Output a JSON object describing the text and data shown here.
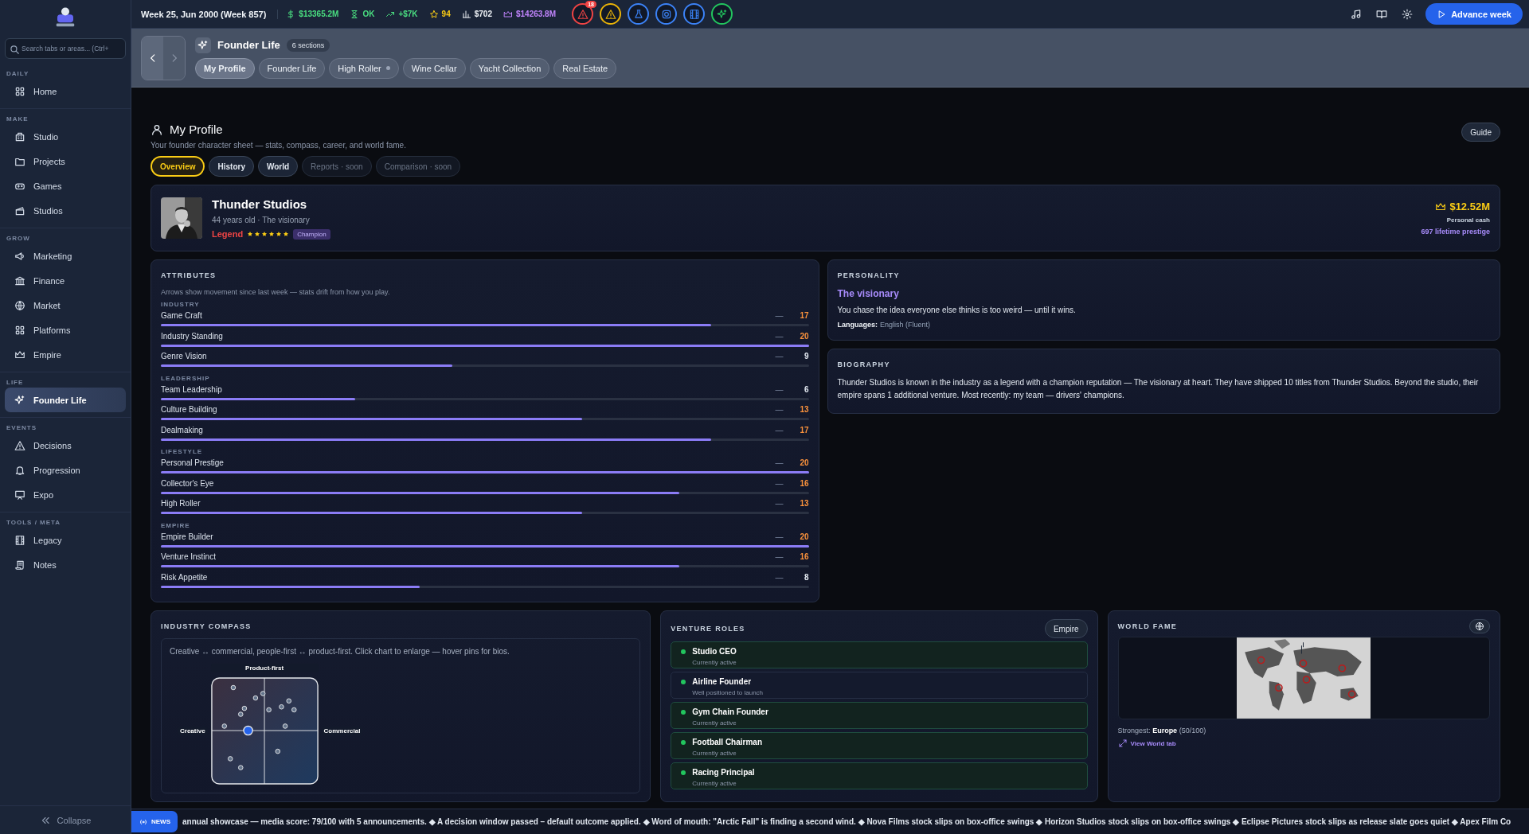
{
  "sidebar": {
    "search": {
      "placeholder": "Search tabs or areas... (Ctrl+"
    },
    "sections": [
      {
        "label": "DAILY",
        "items": [
          {
            "label": "Home",
            "selected": false
          }
        ]
      },
      {
        "label": "MAKE",
        "items": [
          {
            "label": "Studio",
            "selected": false
          },
          {
            "label": "Projects",
            "selected": false
          },
          {
            "label": "Games",
            "selected": false
          },
          {
            "label": "Studios",
            "selected": false
          }
        ]
      },
      {
        "label": "GROW",
        "items": [
          {
            "label": "Marketing",
            "selected": false
          },
          {
            "label": "Finance",
            "selected": false
          },
          {
            "label": "Market",
            "selected": false
          },
          {
            "label": "Platforms",
            "selected": false
          },
          {
            "label": "Empire",
            "selected": false
          }
        ]
      },
      {
        "label": "LIFE",
        "items": [
          {
            "label": "Founder Life",
            "selected": true
          }
        ]
      },
      {
        "label": "EVENTS",
        "items": [
          {
            "label": "Decisions",
            "selected": false
          },
          {
            "label": "Progression",
            "selected": false
          },
          {
            "label": "Expo",
            "selected": false
          }
        ]
      },
      {
        "label": "TOOLS / META",
        "items": [
          {
            "label": "Legacy",
            "selected": false
          },
          {
            "label": "Notes",
            "selected": false
          }
        ]
      }
    ],
    "collapse": "Collapse"
  },
  "top_bar": {
    "week": "Week 25, Jun 2000 (Week 857)",
    "stats": [
      {
        "text": "$13365.2M",
        "color": "#4ade80"
      },
      {
        "text": "OK",
        "color": "#4ade80"
      },
      {
        "text": "+$7K",
        "color": "#4ade80"
      },
      {
        "text": "94",
        "color": "#facc15"
      },
      {
        "text": "$702",
        "color": "#f1f5f9"
      },
      {
        "text": "$14263.8M",
        "color": "#c084fc"
      }
    ],
    "alerts": [
      {
        "color": "#ef4444",
        "badge": "18"
      },
      {
        "color": "#eab308"
      },
      {
        "color": "#3b82f6"
      },
      {
        "color": "#3b82f6"
      },
      {
        "color": "#3b82f6"
      },
      {
        "color": "#22c55e"
      }
    ],
    "advance": "Advance week"
  },
  "area": {
    "title": "Founder Life",
    "count": "6 sections",
    "tabs": [
      {
        "label": "My Profile",
        "selected": true,
        "notified": false
      },
      {
        "label": "Founder Life",
        "selected": false,
        "notified": false
      },
      {
        "label": "High Roller",
        "selected": false,
        "notified": true
      },
      {
        "label": "Wine Cellar",
        "selected": false,
        "notified": false
      },
      {
        "label": "Yacht Collection",
        "selected": false,
        "notified": false
      },
      {
        "label": "Real Estate",
        "selected": false,
        "notified": false
      }
    ]
  },
  "page": {
    "title": "My Profile",
    "subtitle": "Your founder character sheet — stats, compass, career, and world fame.",
    "guide": "Guide",
    "tabs": [
      {
        "label": "Overview",
        "selected": true,
        "disabled": false
      },
      {
        "label": "History",
        "selected": false,
        "disabled": false
      },
      {
        "label": "World",
        "selected": false,
        "disabled": false
      },
      {
        "label": "Reports · soon",
        "selected": false,
        "disabled": true
      },
      {
        "label": "Comparison · soon",
        "selected": false,
        "disabled": true
      }
    ]
  },
  "hero": {
    "name": "Thunder Studios",
    "meta": "44 years old · The visionary",
    "rank": "Legend",
    "stars": 6,
    "badge": "Champion",
    "cash": "$12.52M",
    "cash_label": "Personal cash",
    "prestige": "697 lifetime prestige"
  },
  "attributes": {
    "title": "ATTRIBUTES",
    "note": "Arrows show movement since last week — stats drift from how you play.",
    "groups": [
      {
        "label": "INDUSTRY",
        "rows": [
          {
            "name": "Game Craft",
            "trend": "—",
            "value": "17",
            "level": 0.85
          },
          {
            "name": "Industry Standing",
            "trend": "—",
            "value": "20",
            "level": 1
          },
          {
            "name": "Genre Vision",
            "trend": "—",
            "value": "9",
            "level": 0.45
          }
        ]
      },
      {
        "label": "LEADERSHIP",
        "rows": [
          {
            "name": "Team Leadership",
            "trend": "—",
            "value": "6",
            "level": 0.3
          },
          {
            "name": "Culture Building",
            "trend": "—",
            "value": "13",
            "level": 0.65
          },
          {
            "name": "Dealmaking",
            "trend": "—",
            "value": "17",
            "level": 0.85
          }
        ]
      },
      {
        "label": "LIFESTYLE",
        "rows": [
          {
            "name": "Personal Prestige",
            "trend": "—",
            "value": "20",
            "level": 1
          },
          {
            "name": "Collector's Eye",
            "trend": "—",
            "value": "16",
            "level": 0.8
          },
          {
            "name": "High Roller",
            "trend": "—",
            "value": "13",
            "level": 0.65
          }
        ]
      },
      {
        "label": "EMPIRE",
        "rows": [
          {
            "name": "Empire Builder",
            "trend": "—",
            "value": "20",
            "level": 1
          },
          {
            "name": "Venture Instinct",
            "trend": "—",
            "value": "16",
            "level": 0.8
          },
          {
            "name": "Risk Appetite",
            "trend": "—",
            "value": "8",
            "level": 0.4
          }
        ]
      }
    ]
  },
  "personality": {
    "title": "PERSONALITY",
    "archetype": "The visionary",
    "text": "You chase the idea everyone else thinks is too weird — until it wins.",
    "languages_label": "Languages:",
    "languages": "English (Fluent)"
  },
  "biography": {
    "title": "BIOGRAPHY",
    "text": "Thunder Studios is known in the industry as a legend with a champion reputation — The visionary at heart. They have shipped 10 titles from Thunder Studios. Beyond the studio, their empire spans 1 additional venture. Most recently: my team — drivers' champions."
  },
  "compass": {
    "title": "INDUSTRY COMPASS",
    "text": "Creative ↔ commercial, people-first ↔ product-first. Click chart to enlarge — hover pins for bios.",
    "top": "Product-first",
    "left": "Creative",
    "right": "Commercial"
  },
  "ventures": {
    "title": "VENTURE ROLES",
    "button": "Empire",
    "roles": [
      {
        "name": "Studio CEO",
        "status": "Currently active",
        "active": true
      },
      {
        "name": "Airline Founder",
        "status": "Well positioned to launch",
        "active": false
      },
      {
        "name": "Gym Chain Founder",
        "status": "Currently active",
        "active": true
      },
      {
        "name": "Football Chairman",
        "status": "Currently active",
        "active": true
      },
      {
        "name": "Racing Principal",
        "status": "Currently active",
        "active": true
      }
    ]
  },
  "world_fame": {
    "title": "WORLD FAME",
    "strongest_label": "Strongest:",
    "strongest": "**Europe** (50/100)",
    "link": "View World tab"
  },
  "news": {
    "label": "NEWS",
    "text": "annual showcase — media score: 79/100 with 5 announcements. ◆ A decision window passed – default outcome applied. ◆ Word of mouth: \"Arctic Fall\" is finding a second wind. ◆ Nova Films stock slips on box-office swings ◆ Horizon Studios stock slips on box-office swings ◆ Eclipse Pictures stock slips as release slate goes quiet ◆ Apex Film Co"
  }
}
